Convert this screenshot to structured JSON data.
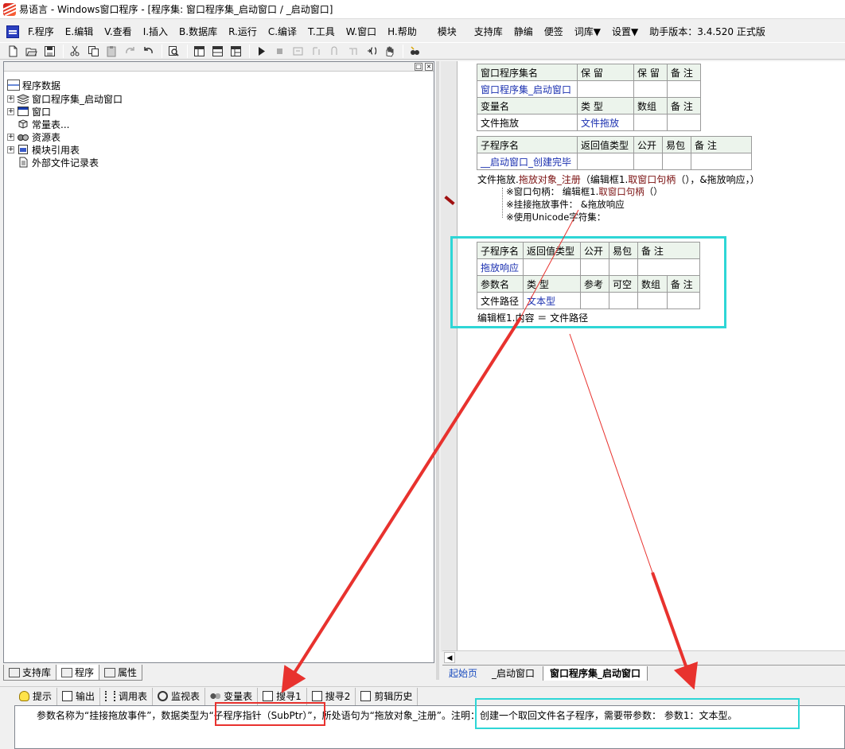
{
  "window": {
    "title": "易语言 - Windows窗口程序 - [程序集: 窗口程序集_启动窗口 / _启动窗口]"
  },
  "menu": {
    "items": [
      "F.程序",
      "E.编辑",
      "V.查看",
      "I.插入",
      "B.数据库",
      "R.运行",
      "C.编译",
      "T.工具",
      "W.窗口",
      "H.帮助",
      "模块",
      "支持库",
      "静编",
      "便签",
      "词库▼",
      "设置▼",
      "助手版本：3.4.520 正式版"
    ]
  },
  "toolbar": {
    "icons": [
      "new-icon",
      "open-icon",
      "save-icon",
      "cut-icon",
      "copy-icon",
      "paste-icon",
      "redo-icon",
      "undo-icon",
      "find-icon",
      "layout1-icon",
      "layout2-icon",
      "layout3-icon",
      "run-icon",
      "stop-icon",
      "step1-icon",
      "step2-icon",
      "step3-icon",
      "step4-icon",
      "step5-icon",
      "hand-icon",
      "debug-icon"
    ]
  },
  "tree": {
    "root": "程序数据",
    "items": [
      "窗口程序集_启动窗口",
      "窗口",
      "常量表...",
      "资源表",
      "模块引用表",
      "外部文件记录表"
    ]
  },
  "left_tabs": [
    "支持库",
    "程序",
    "属性"
  ],
  "editor": {
    "assembly_table": {
      "headers": [
        "窗口程序集名",
        "保 留",
        "保 留",
        "备 注"
      ],
      "row": [
        "窗口程序集_启动窗口",
        "",
        "",
        ""
      ],
      "var_headers": [
        "变量名",
        "类 型",
        "数组",
        "备 注"
      ],
      "var_row": [
        "文件拖放",
        "文件拖放",
        "",
        ""
      ]
    },
    "sub1_table": {
      "headers": [
        "子程序名",
        "返回值类型",
        "公开",
        "易包",
        "备 注"
      ],
      "row": [
        "__启动窗口_创建完毕",
        "",
        "",
        "",
        ""
      ]
    },
    "code1": {
      "prefix": "文件拖放.",
      "method": "拖放对象_注册",
      "args_open": "（编辑框1.",
      "arg_fn": "取窗口句柄",
      "args_close": "（），&拖放响应，）",
      "hint1_label": "※窗口句柄：",
      "hint1_val_a": "编辑框1.",
      "hint1_val_b": "取窗口句柄",
      "hint1_val_c": "（）",
      "hint2": "※挂接拖放事件：  &拖放响应",
      "hint3": "※使用Unicode字符集："
    },
    "sub2_table": {
      "headers": [
        "子程序名",
        "返回值类型",
        "公开",
        "易包",
        "备 注"
      ],
      "row": [
        "拖放响应",
        "",
        "",
        "",
        ""
      ],
      "param_headers": [
        "参数名",
        "类 型",
        "参考",
        "可空",
        "数组",
        "备 注"
      ],
      "param_row": [
        "文件路径",
        "文本型",
        "",
        "",
        "",
        ""
      ]
    },
    "code2": "编辑框1.内容 ＝ 文件路径"
  },
  "editor_tabs": [
    "起始页",
    "_启动窗口",
    "窗口程序集_启动窗口"
  ],
  "bottom_tabs": [
    "提示",
    "输出",
    "调用表",
    "监视表",
    "变量表",
    "搜寻1",
    "搜寻2",
    "剪辑历史"
  ],
  "output": {
    "part1": "参数名称为“挂接拖放事件”，数据类型为",
    "part2": "“子程序指针（SubPtr）”",
    "part3": "，所处语句为“拖放对象_注册”。注明：创建一个取回文件名子程序，需要带参数：  参数1：文本型。"
  },
  "colors": {
    "annotation_red": "#e8322e",
    "annotation_cyan": "#2ed6d6",
    "link_blue": "#1b30b0",
    "header_green": "#ecf4ec"
  }
}
